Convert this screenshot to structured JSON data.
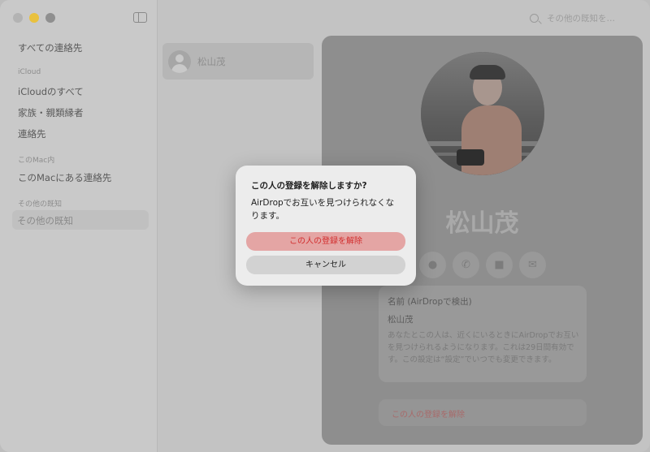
{
  "sidebar": {
    "all_contacts": "すべての連絡先",
    "section_icloud": "iCloud",
    "icloud_all": "iCloudのすべて",
    "family": "家族・親類縁者",
    "contacts": "連絡先",
    "section_mac": "このMac内",
    "mac_contacts": "このMacにある連絡先",
    "section_other": "その他の既知",
    "other_known": "その他の既知"
  },
  "search": {
    "placeholder": "その他の既知を…"
  },
  "list": {
    "items": [
      {
        "name": "松山茂"
      }
    ]
  },
  "detail": {
    "name": "松山茂",
    "info_title": "名前 (AirDropで検出)",
    "info_name": "松山茂",
    "info_desc": "あなたとこの人は、近くにいるときにAirDropでお互いを見つけられるようになります。これは29日間有効です。この設定は“設定”でいつでも変更できます。",
    "remove_label": "この人の登録を解除",
    "actions": [
      "message-icon",
      "phone-icon",
      "video-icon",
      "mail-icon"
    ]
  },
  "dialog": {
    "title": "この人の登録を解除しますか?",
    "message": "AirDropでお互いを見つけられなくなります。",
    "confirm_label": "この人の登録を解除",
    "cancel_label": "キャンセル"
  },
  "colors": {
    "destructive": "#d22d2d",
    "traffic_minimize": "#e9c13e"
  }
}
